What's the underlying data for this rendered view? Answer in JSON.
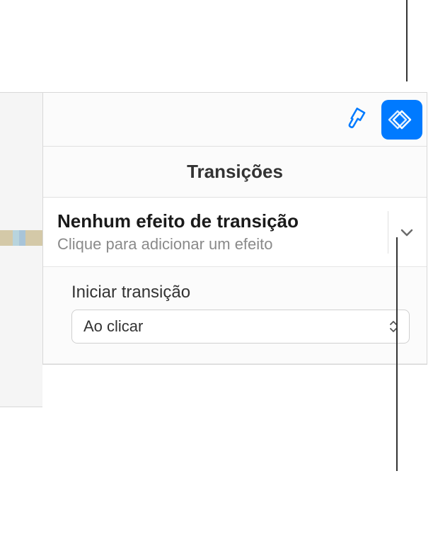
{
  "panel": {
    "title": "Transições"
  },
  "effect": {
    "title": "Nenhum efeito de transição",
    "subtitle": "Clique para adicionar um efeito"
  },
  "start": {
    "label": "Iniciar transição",
    "value": "Ao clicar"
  },
  "toolbar": {
    "format_icon": "format-brush-icon",
    "animate_icon": "animate-diamond-icon"
  }
}
